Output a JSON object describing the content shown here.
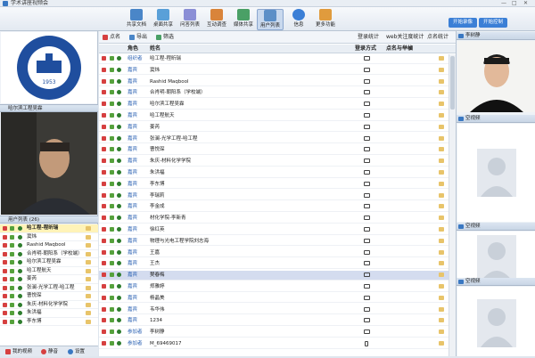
{
  "app": {
    "title": "学术讲座视频会"
  },
  "toolbar": {
    "items": [
      {
        "label": "共享文档",
        "color": "#4a86c8"
      },
      {
        "label": "桌面共享",
        "color": "#5aa0d8"
      },
      {
        "label": "问答列表",
        "color": "#8b8fd6"
      },
      {
        "label": "互动调查",
        "color": "#d9843a"
      },
      {
        "label": "媒体共享",
        "color": "#4aa066"
      },
      {
        "label": "用户列表",
        "color": "#5c8fc7"
      },
      {
        "label": "信息",
        "color": "#3b7fd6"
      },
      {
        "label": "更多功能",
        "color": "#e09b3d"
      }
    ],
    "btn_start_record": "开始录像",
    "btn_start_control": "开始控制"
  },
  "left": {
    "video2_label": "哈尔滨工程吴霖",
    "userlist_header": "用户列表 (26)",
    "users": [
      "哈工程-程昕瑞",
      "窦炜",
      "Rashid Maqbool",
      "合肖明-朝阳系（学校端）",
      "哈尔滨工程吴霖",
      "哈工程航天",
      "姜芮",
      "张澜-光学工程-哈工程",
      "曹悦琛",
      "朱庆-材料化学学院",
      "朱洪福",
      "李东博"
    ],
    "my_video": "我的视频",
    "mute": "静音",
    "settings": "设置"
  },
  "center": {
    "tools": {
      "rollcall": "点名",
      "export": "导出",
      "filter": "筛选",
      "login_stats": "登录统计",
      "web_stats": "web关注度统计",
      "rollcall_stats": "点名统计"
    },
    "columns": {
      "role": "角色",
      "name": "姓名",
      "login": "登录方式",
      "rollcall": "点名与举樐"
    },
    "rows": [
      {
        "role": "组织者",
        "name": "哈工程-程昕瑞",
        "device": "pc"
      },
      {
        "role": "嘉宾",
        "name": "窦炜",
        "device": "pc"
      },
      {
        "role": "嘉宾",
        "name": "Rashid Maqbool",
        "device": "pc"
      },
      {
        "role": "嘉宾",
        "name": "合肖明-朝阳系（学校端）",
        "device": "pc"
      },
      {
        "role": "嘉宾",
        "name": "哈尔滨工程吴霖",
        "device": "pc"
      },
      {
        "role": "嘉宾",
        "name": "哈工程航天",
        "device": "pc"
      },
      {
        "role": "嘉宾",
        "name": "姜芮",
        "device": "pc"
      },
      {
        "role": "嘉宾",
        "name": "张澜-光学工程-哈工程",
        "device": "pc"
      },
      {
        "role": "嘉宾",
        "name": "曹悦琛",
        "device": "pc"
      },
      {
        "role": "嘉宾",
        "name": "朱庆-材料化学学院",
        "device": "pc"
      },
      {
        "role": "嘉宾",
        "name": "朱洪福",
        "device": "pc"
      },
      {
        "role": "嘉宾",
        "name": "李东博",
        "device": "pc"
      },
      {
        "role": "嘉宾",
        "name": "李瑞莉",
        "device": "pc"
      },
      {
        "role": "嘉宾",
        "name": "李金成",
        "device": "pc"
      },
      {
        "role": "嘉宾",
        "name": "材化学院-李新青",
        "device": "pc"
      },
      {
        "role": "嘉宾",
        "name": "徐红英",
        "device": "pc"
      },
      {
        "role": "嘉宾",
        "name": "物理与光电工程学院刘志海",
        "device": "pc"
      },
      {
        "role": "嘉宾",
        "name": "王嘉",
        "device": "pc"
      },
      {
        "role": "嘉宾",
        "name": "王杰",
        "device": "pc"
      },
      {
        "role": "嘉宾",
        "name": "樊春梅",
        "device": "pc"
      },
      {
        "role": "嘉宾",
        "name": "郑雅婷",
        "device": "pc"
      },
      {
        "role": "嘉宾",
        "name": "杨晶美",
        "device": "pc"
      },
      {
        "role": "嘉宾",
        "name": "韦华伟",
        "device": "pc"
      },
      {
        "role": "嘉宾",
        "name": "1234",
        "device": "pc"
      },
      {
        "role": "参加者",
        "name": "李树静",
        "device": "pc"
      },
      {
        "role": "参加者",
        "name": "M_69469017",
        "device": "phone"
      }
    ],
    "selected_index": 19
  },
  "right": {
    "header1": "李树静",
    "header_empty": "空视频"
  }
}
